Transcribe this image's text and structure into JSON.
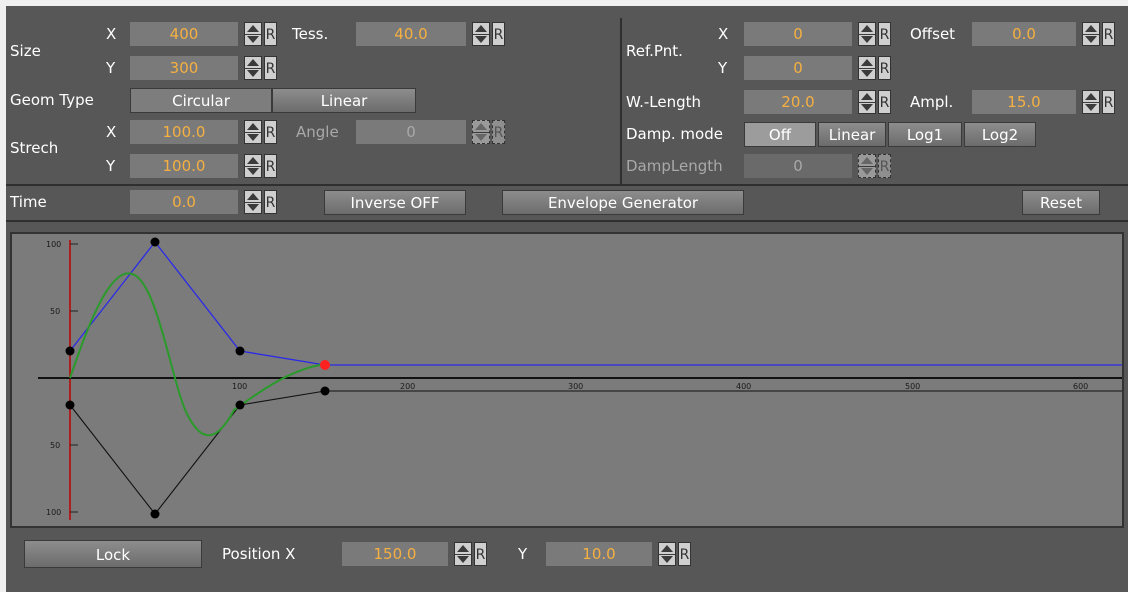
{
  "size": {
    "label": "Size",
    "x_label": "X",
    "x_value": "400",
    "y_label": "Y",
    "y_value": "300"
  },
  "tess": {
    "label": "Tess.",
    "value": "40.0"
  },
  "geom": {
    "label": "Geom Type",
    "options": [
      "Circular",
      "Linear"
    ],
    "selected": "Linear"
  },
  "strech": {
    "label": "Strech",
    "x_label": "X",
    "x_value": "100.0",
    "y_label": "Y",
    "y_value": "100.0"
  },
  "angle": {
    "label": "Angle",
    "value": "0"
  },
  "ref": {
    "label": "Ref.Pnt.",
    "x_label": "X",
    "x_value": "0",
    "y_label": "Y",
    "y_value": "0"
  },
  "offset": {
    "label": "Offset",
    "value": "0.0"
  },
  "wlength": {
    "label": "W.-Length",
    "value": "20.0"
  },
  "ampl": {
    "label": "Ampl.",
    "value": "15.0"
  },
  "damp": {
    "label": "Damp. mode",
    "options": [
      "Off",
      "Linear",
      "Log1",
      "Log2"
    ],
    "selected": "Off"
  },
  "damplength": {
    "label": "DampLength",
    "value": "0"
  },
  "reset_r": "R",
  "time": {
    "label": "Time",
    "value": "0.0"
  },
  "inverse_label": "Inverse OFF",
  "envelope_label": "Envelope Generator",
  "reset_label": "Reset",
  "graph": {
    "y_ticks": [
      "100",
      "50",
      "50",
      "100"
    ],
    "x_ticks": [
      "100",
      "200",
      "300",
      "400",
      "500",
      "600"
    ],
    "colors": {
      "envelope": "#2a2ae8",
      "wave": "#2a9a2a",
      "mirror": "#111111",
      "axis": "#aa2020",
      "selected": "#ff2020"
    }
  },
  "bottom": {
    "lock_label": "Lock",
    "posx_label": "Position X",
    "posx_value": "150.0",
    "y_label": "Y",
    "y_value": "10.0"
  }
}
